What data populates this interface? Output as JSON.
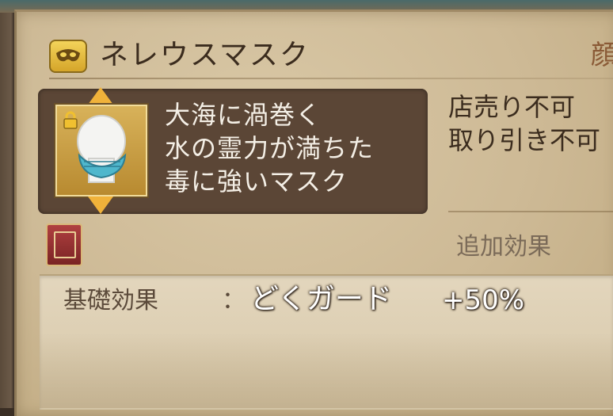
{
  "item": {
    "icon": "mask-icon",
    "name": "ネレウスマスク",
    "edge_char": "顔"
  },
  "description": {
    "lines": [
      "大海に渦巻く",
      "水の霊力が満ちた",
      "毒に強いマスク"
    ]
  },
  "flags": {
    "lines": [
      "店売り不可",
      "取り引き不可"
    ]
  },
  "extra_effect": {
    "label": "追加効果"
  },
  "base_effect": {
    "label": "基礎効果",
    "colon": "：",
    "name": "どくガード",
    "value": "+50%"
  },
  "colors": {
    "parchment": "#d9c8a6",
    "panel": "#5b4636",
    "accent": "#f0b23a"
  }
}
